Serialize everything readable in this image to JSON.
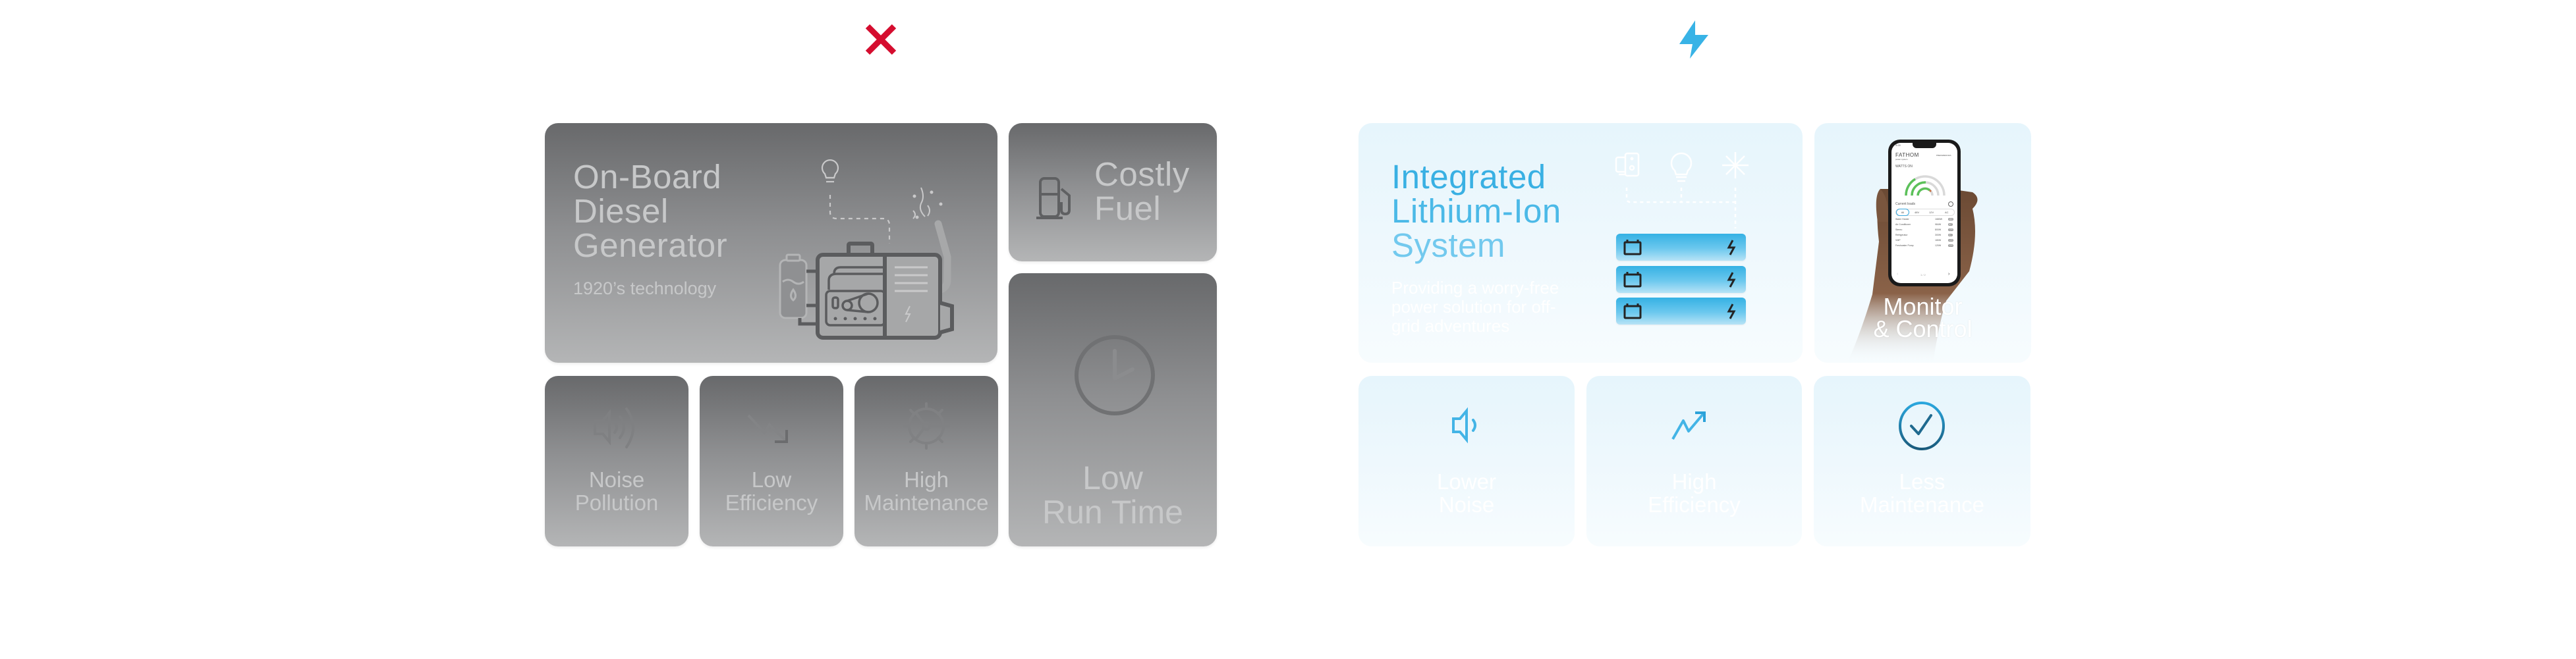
{
  "header": {
    "left_icon": "x-mark-icon",
    "right_icon": "lightning-bolt-icon",
    "colors": {
      "negative": "#d50d2f",
      "positive": "#38b3e6"
    }
  },
  "diesel": {
    "main": {
      "title_lines": [
        "On-Board",
        "Diesel",
        "Generator"
      ],
      "subtitle": "1920’s technology",
      "illustration": "diesel-generator-illustration"
    },
    "costly_fuel": {
      "label_lines": [
        "Costly",
        "Fuel"
      ],
      "icon": "fuel-pump-icon"
    },
    "low_run_time": {
      "label_lines": [
        "Low",
        "Run Time"
      ],
      "icon": "clock-icon"
    },
    "small_cards": [
      {
        "label_lines": [
          "Noise",
          "Pollution"
        ],
        "icon": "loud-speaker-icon"
      },
      {
        "label_lines": [
          "Low",
          "Efficiency"
        ],
        "icon": "trend-down-icon"
      },
      {
        "label_lines": [
          "High",
          "Maintenance"
        ],
        "icon": "gear-icon"
      }
    ]
  },
  "lithium": {
    "main": {
      "title_lines": [
        "Integrated",
        "Lithium-Ion",
        "System"
      ],
      "subtitle": "Providing a worry-free power solution for off-grid adventures",
      "load_icons": [
        "devices-icon",
        "lightbulb-icon",
        "snowflake-icon"
      ],
      "battery_count": 3
    },
    "monitor": {
      "label_lines": [
        "Monitor",
        "& Control"
      ],
      "app": {
        "brand": "FATHOM",
        "brand_sub": "power system",
        "status_time": "9:00",
        "top_right": "PREFERENCES",
        "section": "WATTS ON",
        "current_loads_label": "Current loads",
        "tabs": [
          "All",
          "48V",
          "12V",
          "AC"
        ],
        "active_tab": "All",
        "loads": [
          {
            "name": "Water Heater",
            "watts": "1680W",
            "tag": "48V"
          },
          {
            "name": "Air Conditioner",
            "watts": "984W",
            "tag": "AC"
          },
          {
            "name": "Stereo",
            "watts": "800W",
            "tag": "12V"
          },
          {
            "name": "Refrigerator",
            "watts": "300W",
            "tag": "AC"
          },
          {
            "name": "VMP",
            "watts": "180W",
            "tag": "12V"
          },
          {
            "name": "Freshwater Pump",
            "watts": "120W",
            "tag": "12V"
          }
        ],
        "pagination": "1 / 2"
      }
    },
    "small_cards": [
      {
        "label_lines": [
          "Lower",
          "Noise"
        ],
        "icon": "quiet-speaker-icon"
      },
      {
        "label_lines": [
          "High",
          "Efficiency"
        ],
        "icon": "trend-up-icon"
      },
      {
        "label_lines": [
          "Less",
          "Maintenance"
        ],
        "icon": "check-circle-icon"
      }
    ]
  }
}
